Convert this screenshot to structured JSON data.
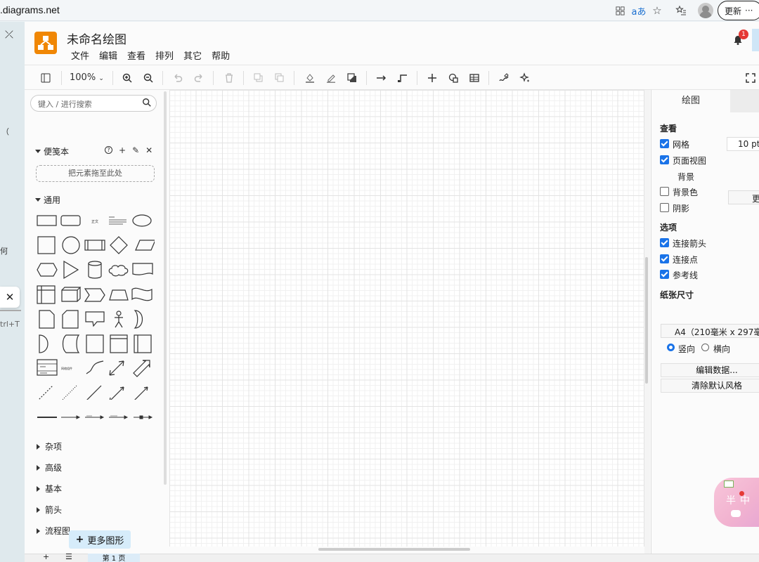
{
  "browser": {
    "url": ".diagrams.net",
    "update_label": "更新",
    "more_label": "···"
  },
  "app": {
    "title": "未命名绘图",
    "menu": [
      "文件",
      "编辑",
      "查看",
      "排列",
      "其它",
      "帮助"
    ],
    "notification_count": "1"
  },
  "toolbar": {
    "zoom": "100%"
  },
  "sidebar": {
    "search_placeholder": "键入 / 进行搜索",
    "scratchpad_label": "便笺本",
    "scratchpad_help": "?",
    "dropzone_text": "把元素拖至此处",
    "general_label": "通用",
    "collapsed_sections": [
      "杂项",
      "高级",
      "基本",
      "箭头",
      "流程图"
    ],
    "more_shapes_label": "更多图形"
  },
  "right_panel": {
    "tab_diagram": "绘图",
    "view_heading": "查看",
    "grid_label": "网格",
    "grid_checked": true,
    "grid_size": "10 pt",
    "page_view_label": "页面视图",
    "page_view_checked": true,
    "background_label": "背景",
    "background_button": "更",
    "bg_color_label": "背景色",
    "bg_color_checked": false,
    "shadow_label": "阴影",
    "shadow_checked": false,
    "options_heading": "选项",
    "connection_arrows_label": "连接箭头",
    "connection_arrows_checked": true,
    "connection_points_label": "连接点",
    "connection_points_checked": true,
    "guides_label": "参考线",
    "guides_checked": true,
    "paper_size_heading": "纸张尺寸",
    "paper_size_value": "A4（210毫米 x 297毫",
    "portrait_label": "竖向",
    "portrait_checked": true,
    "landscape_label": "横向",
    "landscape_checked": false,
    "edit_data_button": "编辑数据...",
    "clear_style_button": "清除默认风格"
  },
  "bottom": {
    "page_tab": "第 1 页"
  },
  "edge_panel": {
    "shortcut_hint": "trl+T",
    "fragment_1": "（",
    "fragment_2": "何"
  },
  "mascot": {
    "text": "半中"
  }
}
